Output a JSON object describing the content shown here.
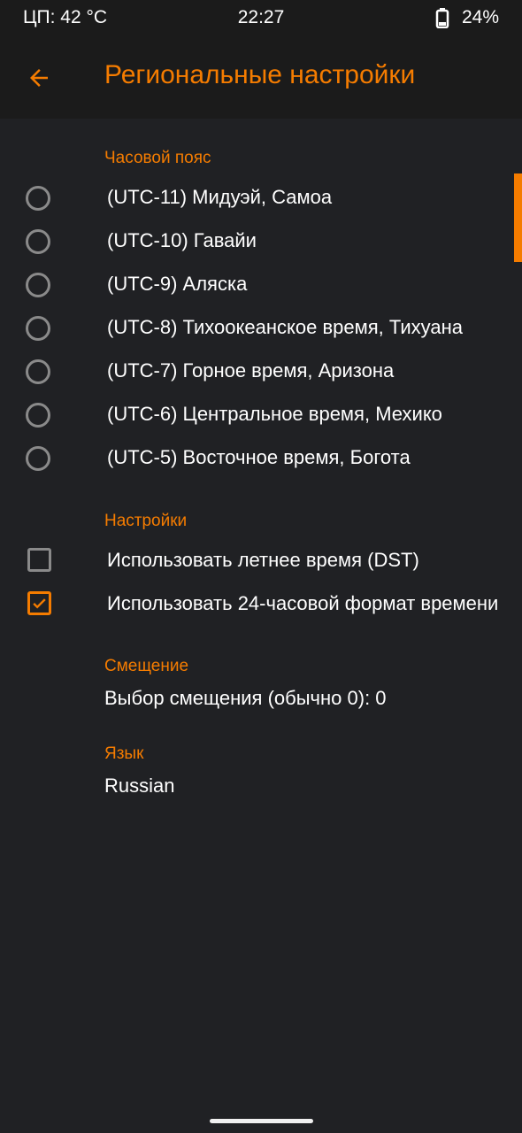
{
  "status_bar": {
    "cpu_temp": "ЦП: 42 °C",
    "time": "22:27",
    "battery": "24%"
  },
  "app_bar": {
    "title": "Региональные настройки",
    "back_icon": "arrow-back-icon"
  },
  "timezone_section": {
    "header": "Часовой пояс",
    "options": [
      "(UTC-11) Мидуэй, Самоа",
      "(UTC-10) Гавайи",
      "(UTC-9) Аляска",
      "(UTC-8) Тихоокеанское время, Тихуана",
      "(UTC-7) Горное время, Аризона",
      "(UTC-6) Центральное время, Мехико",
      "(UTC-5) Восточное время, Богота"
    ]
  },
  "settings_section": {
    "header": "Настройки",
    "dst_label": "Использовать летнее время (DST)",
    "dst_checked": false,
    "format24_label": "Использовать 24-часовой формат времени",
    "format24_checked": true
  },
  "offset_section": {
    "header": "Смещение",
    "value": "Выбор смещения (обычно 0): 0"
  },
  "language_section": {
    "header": "Язык",
    "value": "Russian"
  },
  "colors": {
    "accent": "#f57c00",
    "background": "#202124",
    "bar_background": "#1b1b1b"
  }
}
